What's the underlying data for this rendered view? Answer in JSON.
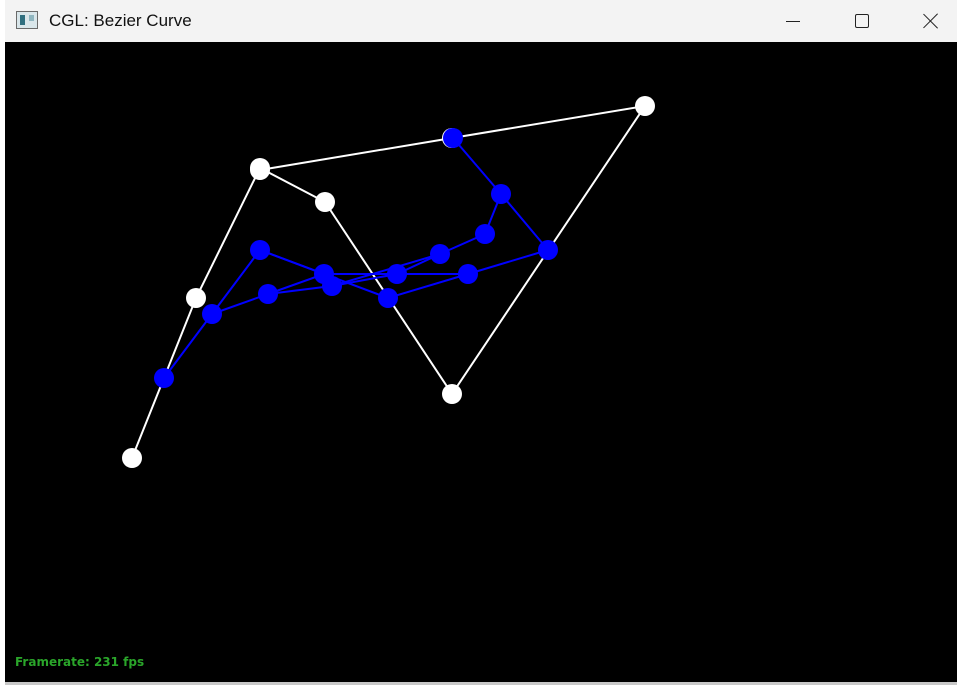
{
  "window": {
    "title": "CGL: Bezier Curve",
    "controls": {
      "minimize": "minimize-icon",
      "maximize": "maximize-icon",
      "close": "close-icon"
    }
  },
  "status": {
    "framerate": "Framerate: 231 fps"
  },
  "colors": {
    "control": "#ffffff",
    "intermediate": "#0000ff",
    "background": "#000000",
    "fps_text": "#2aa52a"
  },
  "curve": {
    "control_points": [
      [
        127,
        416
      ],
      [
        191,
        256
      ],
      [
        255,
        126
      ],
      [
        320,
        160
      ],
      [
        447,
        352
      ],
      [
        640,
        64
      ],
      [
        447,
        96
      ],
      [
        255,
        128
      ]
    ],
    "levels": [
      [
        [
          159,
          336
        ],
        [
          207,
          272
        ],
        [
          255,
          208
        ],
        [
          383,
          256
        ],
        [
          543,
          208
        ],
        [
          496,
          152
        ],
        [
          448,
          96
        ]
      ],
      [
        [
          207,
          272
        ],
        [
          263,
          252
        ],
        [
          327,
          244
        ],
        [
          462,
          232
        ],
        [
          480,
          192
        ],
        [
          480,
          192
        ]
      ],
      [
        [
          263,
          252
        ],
        [
          319,
          232
        ],
        [
          391,
          232
        ],
        [
          463,
          212
        ],
        [
          463,
          212
        ]
      ],
      [
        [
          319,
          232
        ],
        [
          435,
          212
        ],
        [
          327,
          244
        ],
        [
          384,
          256
        ]
      ]
    ],
    "intermediate_segments": [
      [
        [
          159,
          336
        ],
        [
          207,
          272
        ],
        [
          255,
          208
        ],
        [
          383,
          256
        ],
        [
          463,
          232
        ],
        [
          543,
          208
        ],
        [
          496,
          152
        ],
        [
          448,
          96
        ]
      ],
      [
        [
          207,
          272
        ],
        [
          263,
          252
        ],
        [
          327,
          244
        ],
        [
          392,
          232
        ],
        [
          435,
          212
        ],
        [
          480,
          192
        ],
        [
          496,
          152
        ]
      ],
      [
        [
          263,
          252
        ],
        [
          319,
          232
        ],
        [
          392,
          232
        ],
        [
          463,
          232
        ]
      ],
      [
        [
          255,
          208
        ],
        [
          319,
          232
        ],
        [
          327,
          244
        ],
        [
          435,
          212
        ]
      ]
    ],
    "intermediate_points": [
      [
        159,
        336
      ],
      [
        207,
        272
      ],
      [
        255,
        208
      ],
      [
        263,
        252
      ],
      [
        319,
        232
      ],
      [
        327,
        244
      ],
      [
        383,
        256
      ],
      [
        392,
        232
      ],
      [
        435,
        212
      ],
      [
        463,
        232
      ],
      [
        480,
        192
      ],
      [
        496,
        152
      ],
      [
        543,
        208
      ],
      [
        448,
        96
      ]
    ]
  }
}
